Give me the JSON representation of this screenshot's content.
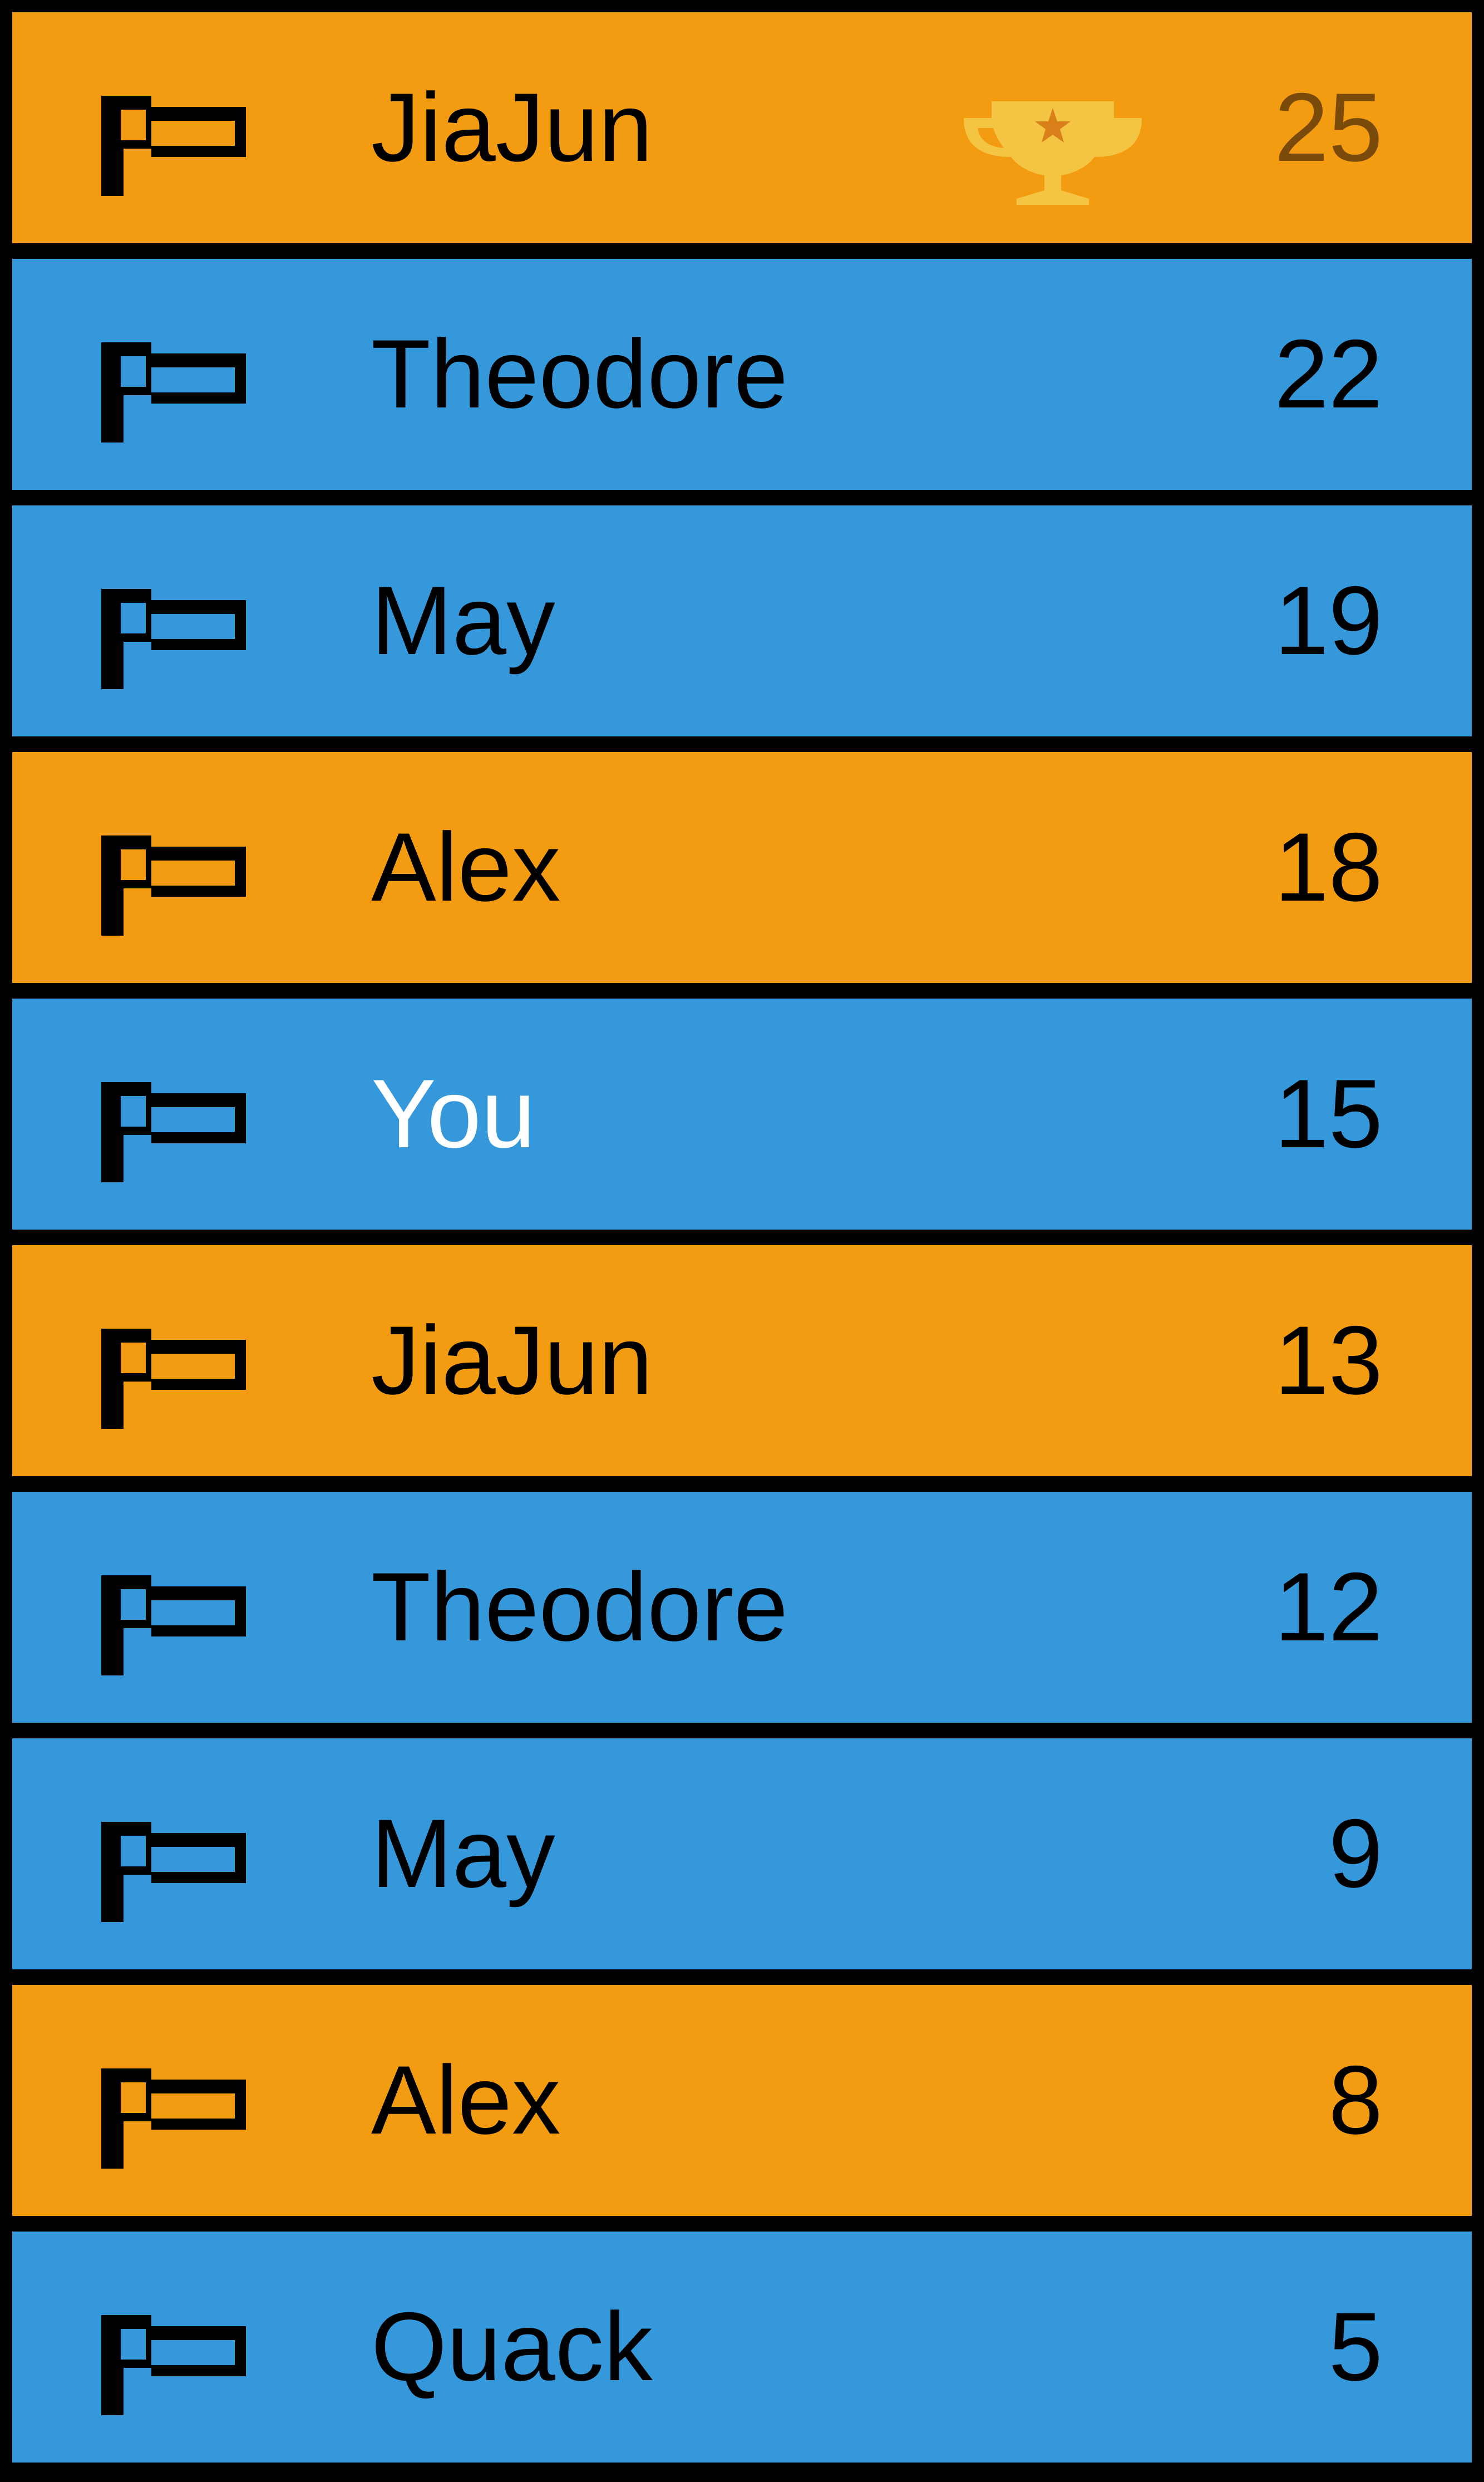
{
  "leaderboard": {
    "colors": {
      "orange": "#f39c12",
      "blue": "#3498db",
      "border": "#000000",
      "trophy": "#f4c542",
      "highlight_name": "#ffffff"
    },
    "rows": [
      {
        "name": "JiaJun",
        "score": "25",
        "color": "orange",
        "icon": "trophy-icon"
      },
      {
        "name": "Theodore",
        "score": "22",
        "color": "blue"
      },
      {
        "name": "May",
        "score": "19",
        "color": "blue"
      },
      {
        "name": "Alex",
        "score": "18",
        "color": "orange"
      },
      {
        "name": "You",
        "score": "15",
        "color": "blue",
        "is_current_user": true
      },
      {
        "name": "JiaJun",
        "score": "13",
        "color": "orange"
      },
      {
        "name": "Theodore",
        "score": "12",
        "color": "blue"
      },
      {
        "name": "May",
        "score": "9",
        "color": "blue"
      },
      {
        "name": "Alex",
        "score": "8",
        "color": "orange"
      },
      {
        "name": "Quack",
        "score": "5",
        "color": "blue"
      }
    ]
  }
}
